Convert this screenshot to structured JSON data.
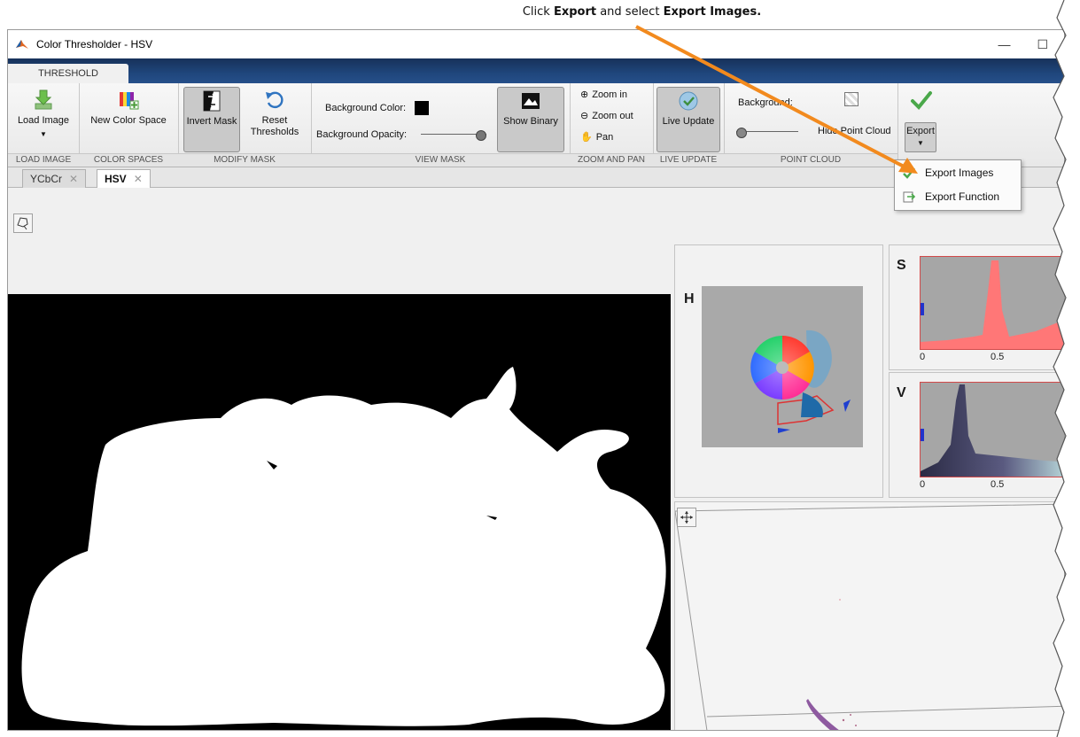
{
  "callout": {
    "prefix": "Click ",
    "bold1": "Export",
    "middle": " and select ",
    "bold2": "Export Images."
  },
  "window": {
    "title": "Color Thresholder - HSV"
  },
  "ribbon": {
    "tab_label": "THRESHOLD",
    "buttons": {
      "load_image": "Load Image",
      "new_color_space": "New Color Space",
      "invert_mask": "Invert Mask",
      "reset_line1": "Reset",
      "reset_line2": "Thresholds",
      "background_color": "Background Color:",
      "background_opacity": "Background Opacity:",
      "show_binary": "Show Binary",
      "zoom_in": "Zoom in",
      "zoom_out": "Zoom out",
      "pan": "Pan",
      "live_update": "Live Update",
      "background": "Background:",
      "hide_point_cloud": "Hide Point Cloud",
      "export": "Export"
    },
    "sections": {
      "load_image": "LOAD IMAGE",
      "color_spaces": "COLOR SPACES",
      "modify_mask": "MODIFY MASK",
      "view_mask": "VIEW MASK",
      "zoom_and_pan": "ZOOM AND PAN",
      "live_update": "LIVE UPDATE",
      "point_cloud": "POINT CLOUD"
    }
  },
  "doc_tabs": [
    "YCbCr",
    "HSV"
  ],
  "export_menu": {
    "items": [
      "Export Images",
      "Export Function"
    ]
  },
  "histograms": {
    "h_label": "H",
    "s_label": "S",
    "v_label": "V",
    "s_ticks": [
      "0",
      "0.5"
    ],
    "v_ticks": [
      "0",
      "0.5"
    ]
  },
  "colors": {
    "ribbon_band": "#1f467c",
    "callout_arrow": "#f28a1e",
    "check_green": "#4aa84a"
  },
  "icons": {
    "app": "matlab-icon",
    "load_image": "download-arrow-icon",
    "new_color_space": "color-space-icon",
    "invert_mask": "invert-mask-icon",
    "reset": "reset-icon",
    "show_binary": "binary-image-icon",
    "live_update": "live-update-icon",
    "export": "check-icon"
  }
}
